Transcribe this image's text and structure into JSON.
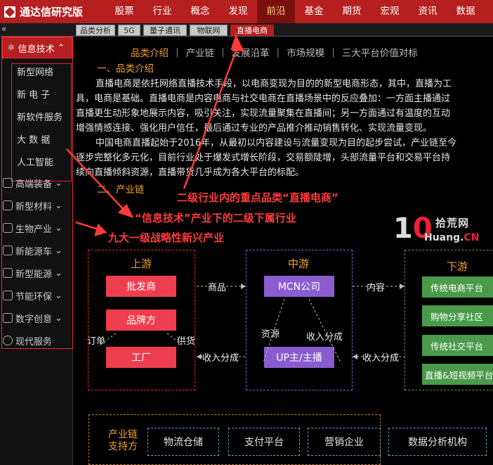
{
  "app": {
    "title": "通达信研究版"
  },
  "topnav": [
    "股票",
    "行业",
    "概念",
    "发现",
    "前沿",
    "基金",
    "期货",
    "宏观",
    "资讯",
    "数据"
  ],
  "topnav_active": 4,
  "subtabs": [
    "品类分析",
    "5G",
    "量子通讯",
    "物联网",
    "直播电商"
  ],
  "subtabs_active": 4,
  "sidebar": {
    "collapse_glyph": "«",
    "main": "信息技术",
    "subs": [
      "新型网络",
      "新 电 子",
      "新软件服务",
      "大 数 据",
      "人工智能"
    ],
    "cats": [
      "高端装备",
      "新型材料",
      "生物产业",
      "新能源车",
      "新型能源",
      "节能环保",
      "数字创意",
      "现代服务"
    ]
  },
  "content_tabs": [
    "品类介绍",
    "产业链",
    "发展沿革",
    "市场规模",
    "三大平台价值对标"
  ],
  "content_tabs_active": 0,
  "intro": {
    "heading1": "一、品类介绍",
    "p1a": "直播电商是依托网络直播技术手段，以电商变现为目的的新型电商形态，其中，直播为工",
    "p1b": "具，电商是基础。直播电商是内容电商与社交电商在直播场景中的反应叠加：一方面主播通过",
    "p1c": "直播更生动形象地展示内容，吸引关注，实现流量聚集在直播间；另一方面通过有温度的互动",
    "p1d": "增强情感连接、强化用户信任，最后通过专业的产品推介推动销售转化、实现流量变现。",
    "p2a": "中国电商直播起始于2016年，从最初以内容建设与流量变现为目的起步尝试，产业链至今",
    "p2b": "逐步完整化多元化，目前行业处于爆发式增长阶段，交易额陡增，头部流量平台和交易平台持",
    "p2c": "续向直播倾斜资源，直播带货几乎成为各大平台的标配。",
    "heading2": "二、产业链"
  },
  "annotations": {
    "a1": "二级行业内的重点品类“直播电商”",
    "a2": "“信息技术”产业下的二级下属行业",
    "a3": "九大一级战略性新兴产业"
  },
  "watermark": {
    "num_zero": "1",
    "num_rest": "0",
    "cn": "拾荒网",
    "en_a": "Huang.",
    "en_b": "10",
    "en_c": "CN"
  },
  "chain": {
    "upstream": "上游",
    "midstream": "中游",
    "downstream": "下游",
    "wholesale": "批发商",
    "brand": "品牌方",
    "factory": "工厂",
    "mcn": "MCN公司",
    "streamer": "UP主/主播",
    "down1": "传统电商平台",
    "down2": "购物分享社区",
    "down3": "传统社交平台",
    "down4": "直播&短视频平台",
    "l_goods": "商品",
    "l_content": "内容",
    "l_order": "订单",
    "l_supply": "供货",
    "l_resource": "资源",
    "l_share1": "收入分成",
    "l_share2": "收入分成",
    "l_share3": "收入分成"
  },
  "support": {
    "title1": "产业链",
    "title2": "支持方",
    "items": [
      "物流仓储",
      "支付平台",
      "营销企业",
      "数据分析机构"
    ]
  },
  "colors": {
    "brand_red": "#b51f1f",
    "accent_orange": "#f0a030",
    "annotation_red": "#ff3a3a"
  }
}
